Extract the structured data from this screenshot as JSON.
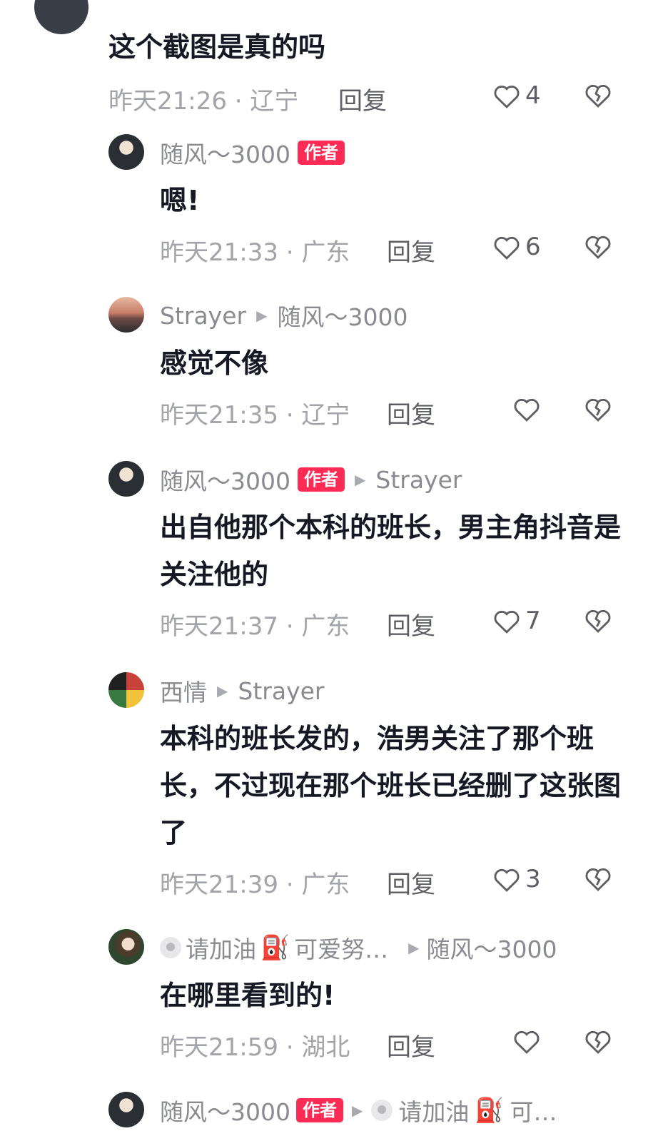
{
  "comments": [
    {
      "text": "这个截图是真的吗",
      "time": "昨天21:26 · 辽宁",
      "reply": "回复",
      "likes": "4"
    },
    {
      "user": "随风〜3000",
      "tag": "作者",
      "text": "嗯!",
      "time": "昨天21:33 · 广东",
      "reply": "回复",
      "likes": "6"
    },
    {
      "user": "Strayer",
      "reply_to": "随风〜3000",
      "text": "感觉不像",
      "time": "昨天21:35 · 辽宁",
      "reply": "回复",
      "likes": ""
    },
    {
      "user": "随风〜3000",
      "tag": "作者",
      "reply_to": "Strayer",
      "text": "出自他那个本科的班长，男主角抖音是关注他的",
      "time": "昨天21:37 · 广东",
      "reply": "回复",
      "likes": "7"
    },
    {
      "user": "西情",
      "reply_to": "Strayer",
      "text": "本科的班长发的，浩男关注了那个班长，不过现在那个班长已经删了这张图了",
      "time": "昨天21:39 · 广东",
      "reply": "回复",
      "likes": "3"
    },
    {
      "user": "请加油",
      "user_suffix": "可爱努…",
      "reply_to": "随风〜3000",
      "text": "在哪里看到的!",
      "time": "昨天21:59 · 湖北",
      "reply": "回复",
      "likes": ""
    },
    {
      "user": "随风〜3000",
      "tag": "作者",
      "reply_to": "请加油",
      "reply_to_suffix": "可…"
    }
  ],
  "colors": {
    "accent": "#fe2c55",
    "text": "#161823",
    "meta": "#a3a4a9"
  },
  "icons": [
    "heart-outline-icon",
    "broken-heart-icon",
    "play-arrow-icon",
    "fuel-pump-emoji-icon"
  ]
}
